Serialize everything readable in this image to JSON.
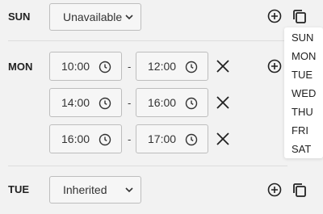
{
  "days": {
    "sun": {
      "label": "SUN",
      "select_value": "Unavailable"
    },
    "mon": {
      "label": "MON",
      "slots": [
        {
          "start": "10:00",
          "end": "12:00"
        },
        {
          "start": "14:00",
          "end": "16:00"
        },
        {
          "start": "16:00",
          "end": "17:00"
        }
      ]
    },
    "tue": {
      "label": "TUE",
      "select_value": "Inherited"
    }
  },
  "range_separator": "-",
  "copy_menu": {
    "options": [
      "SUN",
      "MON",
      "TUE",
      "WED",
      "THU",
      "FRI",
      "SAT"
    ]
  },
  "icons": [
    "chevron-down-icon",
    "clock-icon",
    "close-icon",
    "plus-circle-icon",
    "copy-icon"
  ]
}
